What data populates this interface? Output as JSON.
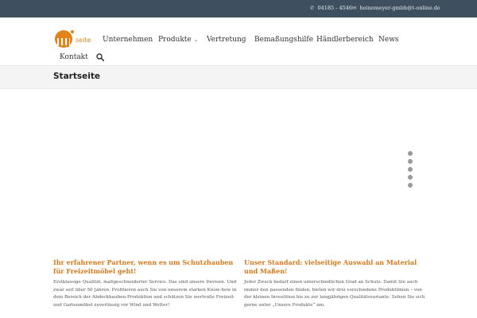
{
  "topbar": {
    "phone": "04185 - 4546",
    "email": "heinemeyer-gmbh@t-online.de"
  },
  "header": {
    "logo_text": "seite",
    "nav": [
      {
        "label": "Unternehmen"
      },
      {
        "label": "Produkte"
      },
      {
        "label": "Vertretung"
      },
      {
        "label": "Bemaßungshilfe"
      },
      {
        "label": "Händlerbereich"
      },
      {
        "label": "News"
      },
      {
        "label": "Kontakt"
      }
    ]
  },
  "page": {
    "title": "Startseite"
  },
  "slider": {
    "slide_count": 5,
    "active_index": 0
  },
  "columns": [
    {
      "heading": "Ihr erfahrener Partner, wenn es um Schutzhauben für Freizeitmöbel geht!",
      "text": "Erstklassige Qualität, maßgeschneiderter Service. Das sind unsere Devisen. Und zwar seit über 50 Jahren. Profitieren auch Sie von unserem starken Know-how in dem Bereich der Abdeckhauben-Produktion und schützen Sie wertvolle Freizeit- und Gartenmöbel zuverlässig vor Wind und Wetter!"
    },
    {
      "heading": "Unser Standard: vielseitige Auswahl an Material und Maßen!",
      "text": "Jeder Zweck bedarf einen unterschiedlichen Grad an Schutz. Damit Sie auch immer den passenden finden, bieten wir drei verschiedene Produktlinien – von der kleinen Investition bis zu zur langjährigen Qualitätsvariante. Sehen Sie sich gerne unter „Unsere Produkte“ um."
    }
  ],
  "colors": {
    "topbar": "#3e5060",
    "accent": "#e1851b",
    "heading": "#d9781a"
  },
  "icons": [
    "phone-icon",
    "mail-icon",
    "chevron-down-icon",
    "search-icon"
  ]
}
